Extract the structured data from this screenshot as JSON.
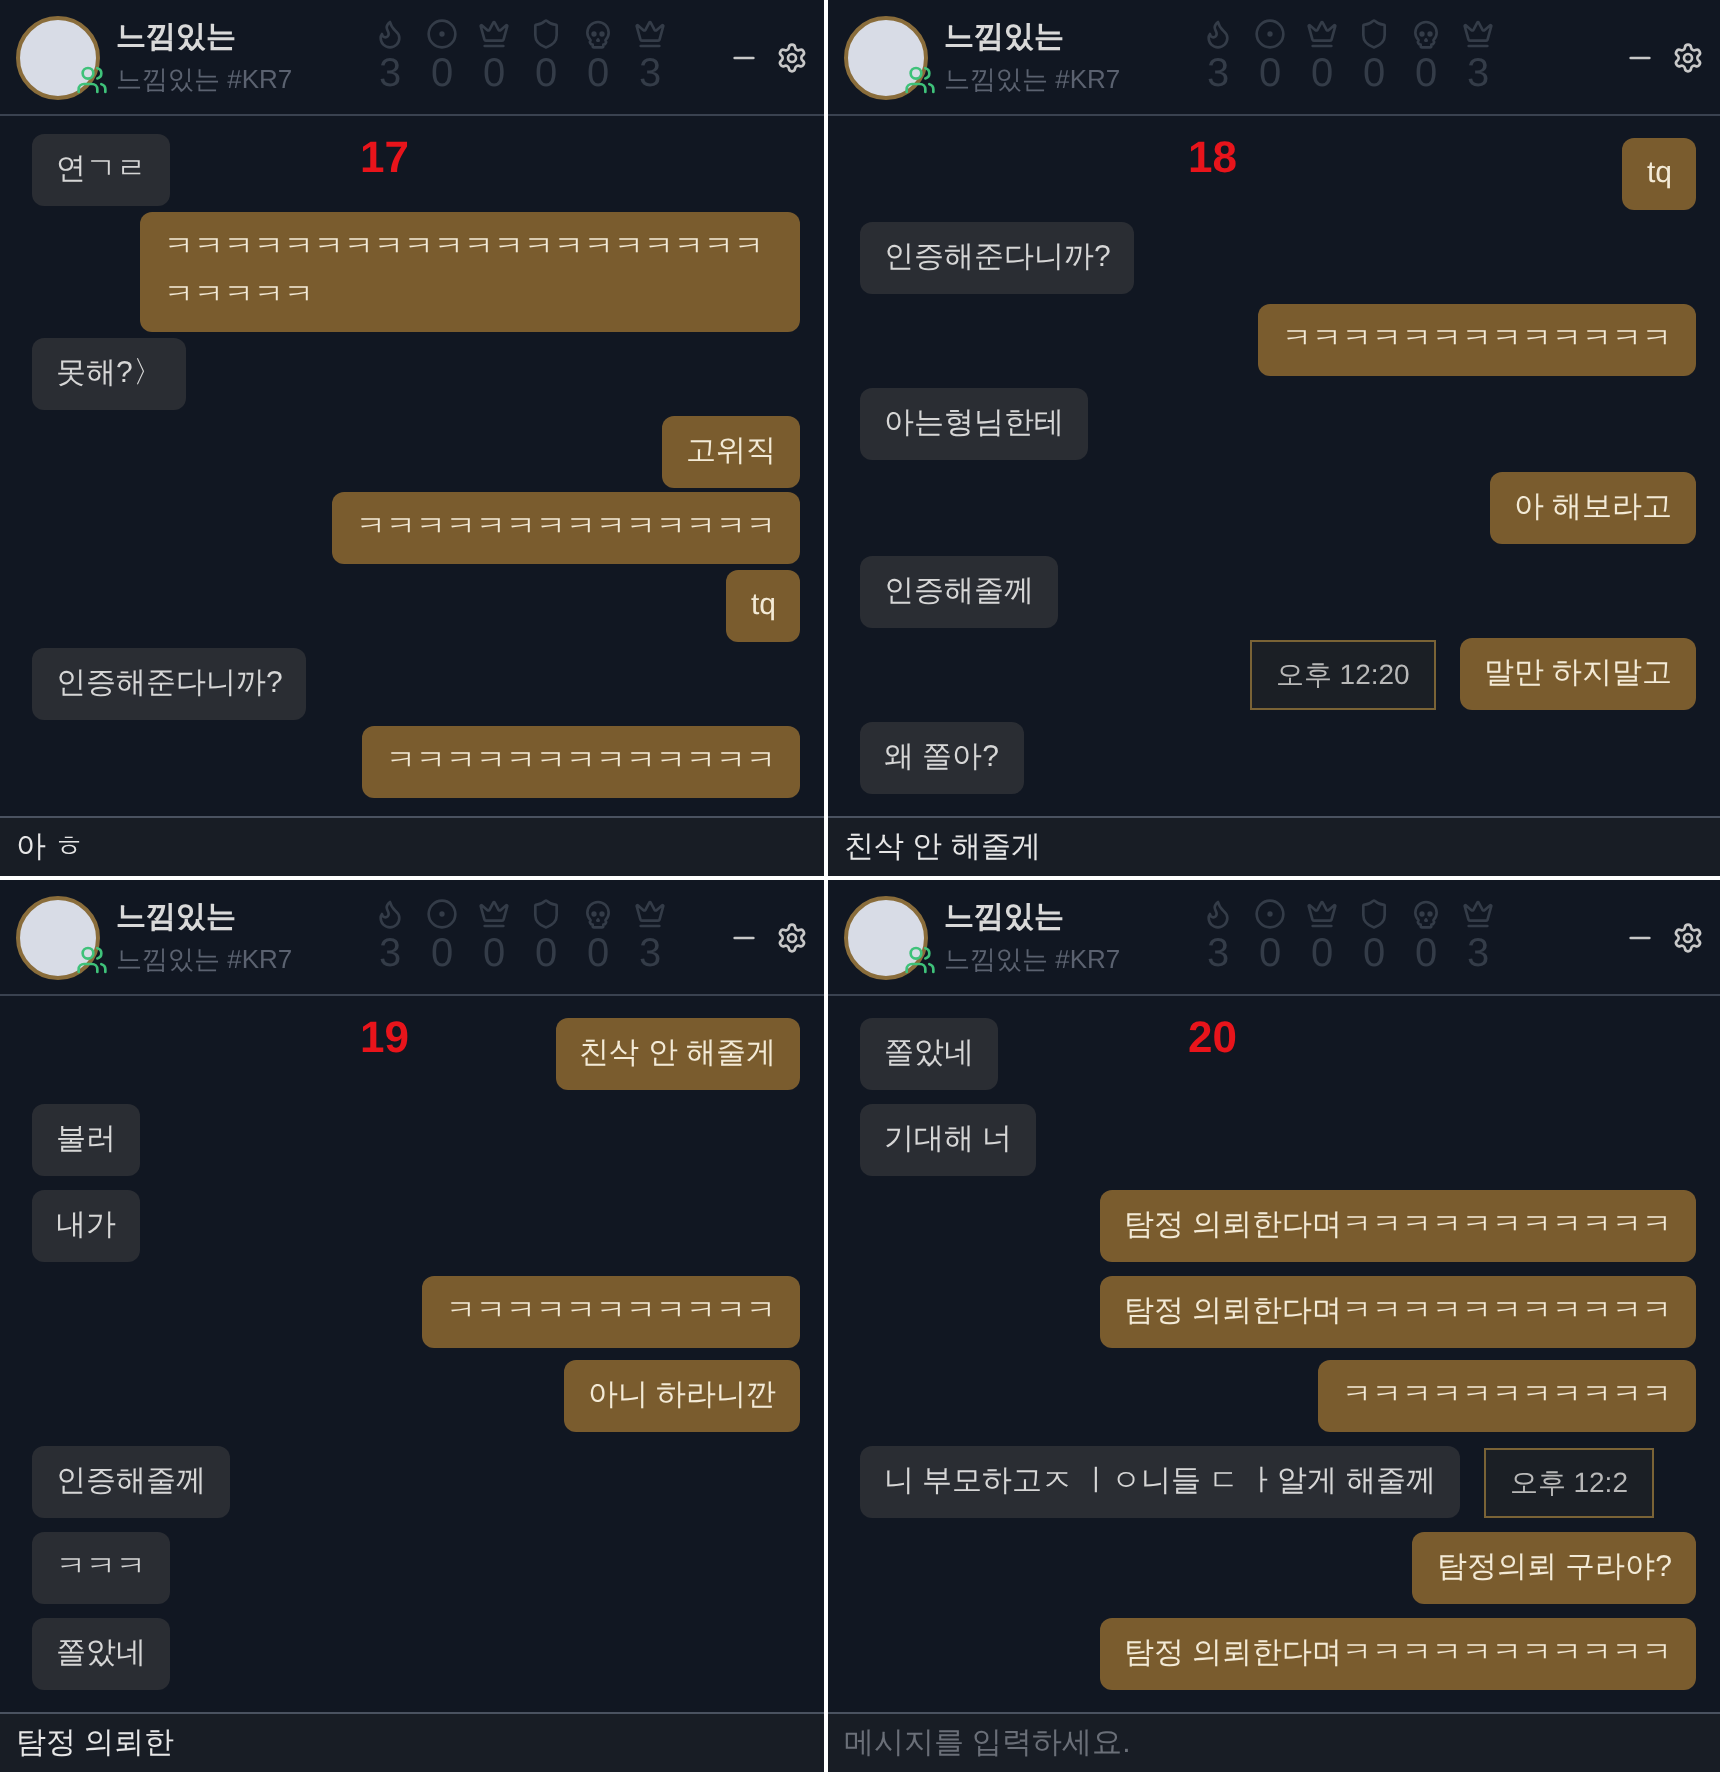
{
  "panels": [
    {
      "label": "17",
      "name": "느낌있는",
      "tag": "느낌있는 #KR7",
      "stats": [
        "3",
        "0",
        "0",
        "0",
        "0",
        "3"
      ],
      "messages": [
        {
          "text": "연ㄱㄹ",
          "kind": "received"
        },
        {
          "text": "ㅋㅋㅋㅋㅋㅋㅋㅋㅋㅋㅋㅋㅋㅋㅋㅋㅋㅋㅋㅋㅋㅋㅋㅋㅋ",
          "kind": "sent"
        },
        {
          "text": "못해?〉",
          "kind": "received"
        },
        {
          "text": "고위직",
          "kind": "sent"
        },
        {
          "text": "ㅋㅋㅋㅋㅋㅋㅋㅋㅋㅋㅋㅋㅋㅋ",
          "kind": "sent"
        },
        {
          "text": "tq",
          "kind": "sent"
        },
        {
          "text": "인증해준다니까?",
          "kind": "received"
        },
        {
          "text": "ㅋㅋㅋㅋㅋㅋㅋㅋㅋㅋㅋㅋㅋ",
          "kind": "sent"
        }
      ],
      "input": {
        "value": "아 ㅎ"
      }
    },
    {
      "label": "18",
      "name": "느낌있는",
      "tag": "느낌있는 #KR7",
      "stats": [
        "3",
        "0",
        "0",
        "0",
        "0",
        "3"
      ],
      "messages": [
        {
          "text": "tq",
          "kind": "sent"
        },
        {
          "text": "인증해준다니까?",
          "kind": "received"
        },
        {
          "text": "ㅋㅋㅋㅋㅋㅋㅋㅋㅋㅋㅋㅋㅋ",
          "kind": "sent"
        },
        {
          "text": "아는형님한테",
          "kind": "received"
        },
        {
          "text": "아 해보라고",
          "kind": "sent"
        },
        {
          "text": "인증해줄께",
          "kind": "received"
        },
        {
          "text": "말만 하지말고",
          "kind": "sent",
          "time": "오후 12:20"
        },
        {
          "text": "왜 쫄아?",
          "kind": "received"
        }
      ],
      "input": {
        "value": "친삭 안 해줄게"
      }
    },
    {
      "label": "19",
      "name": "느낌있는",
      "tag": "느낌있는 #KR7",
      "stats": [
        "3",
        "0",
        "0",
        "0",
        "0",
        "3"
      ],
      "messages": [
        {
          "text": "친삭 안 해줄게",
          "kind": "sent"
        },
        {
          "text": "불러",
          "kind": "received"
        },
        {
          "text": "내가",
          "kind": "received"
        },
        {
          "text": "ㅋㅋㅋㅋㅋㅋㅋㅋㅋㅋㅋ",
          "kind": "sent"
        },
        {
          "text": "아니 하라니깐",
          "kind": "sent"
        },
        {
          "text": "인증해줄께",
          "kind": "received"
        },
        {
          "text": "ㅋㅋㅋ",
          "kind": "received"
        },
        {
          "text": "쫄았네",
          "kind": "received"
        }
      ],
      "input": {
        "value": "탐정 의뢰한"
      }
    },
    {
      "label": "20",
      "name": "느낌있는",
      "tag": "느낌있는 #KR7",
      "stats": [
        "3",
        "0",
        "0",
        "0",
        "0",
        "3"
      ],
      "messages": [
        {
          "text": "쫄았네",
          "kind": "received"
        },
        {
          "text": "기대해 너",
          "kind": "received"
        },
        {
          "text": "탐정 의뢰한다며ㅋㅋㅋㅋㅋㅋㅋㅋㅋㅋㅋ",
          "kind": "sent"
        },
        {
          "text": "탐정 의뢰한다며ㅋㅋㅋㅋㅋㅋㅋㅋㅋㅋㅋ",
          "kind": "sent"
        },
        {
          "text": "ㅋㅋㅋㅋㅋㅋㅋㅋㅋㅋㅋ",
          "kind": "sent"
        },
        {
          "text": "니 부모하고ㅈ ㅣㅇ니들 ㄷ ㅏ알게 해줄께",
          "kind": "received",
          "time": "오후 12:2"
        },
        {
          "text": "탐정의뢰 구라야?",
          "kind": "sent"
        },
        {
          "text": "탐정 의뢰한다며ㅋㅋㅋㅋㅋㅋㅋㅋㅋㅋㅋ",
          "kind": "sent"
        }
      ],
      "input": {
        "placeholder": "메시지를 입력하세요."
      }
    }
  ]
}
